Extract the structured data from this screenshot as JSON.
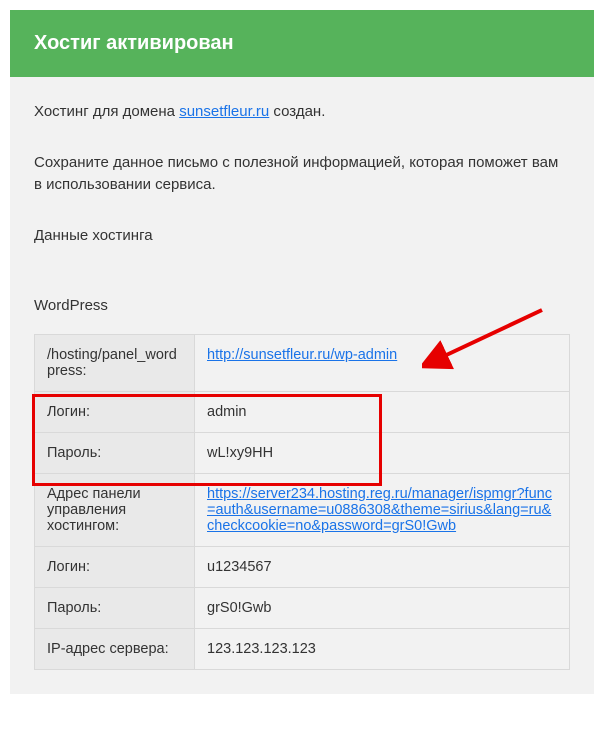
{
  "header": {
    "title": "Хостиг активирован"
  },
  "intro": {
    "line1_pre": "Хостинг для домена ",
    "domain_link_text": "sunsetfleur.ru",
    "line1_post": " создан.",
    "line2": "Сохраните данное письмо с полезной информацией, которая поможет вам в использовании сервиса.",
    "line3": "Данные хостинга"
  },
  "section": {
    "title": "WordPress"
  },
  "table": {
    "rows": [
      {
        "key": "/hosting/panel_wordpress:",
        "val_link": "http://sunsetfleur.ru/wp-admin"
      },
      {
        "key": "Логин:",
        "val": "admin"
      },
      {
        "key": "Пароль:",
        "val": "wL!xy9HH"
      },
      {
        "key": "Адрес панели управления хостингом:",
        "val_link": "https://server234.hosting.reg.ru/manager/ispmgr?func=auth&username=u0886308&theme=sirius&lang=ru&checkcookie=no&password=grS0!Gwb"
      },
      {
        "key": "Логин:",
        "val": "u1234567"
      },
      {
        "key": "Пароль:",
        "val": "grS0!Gwb"
      },
      {
        "key": "IP-адрес сервера:",
        "val": "123.123.123.123"
      }
    ]
  }
}
